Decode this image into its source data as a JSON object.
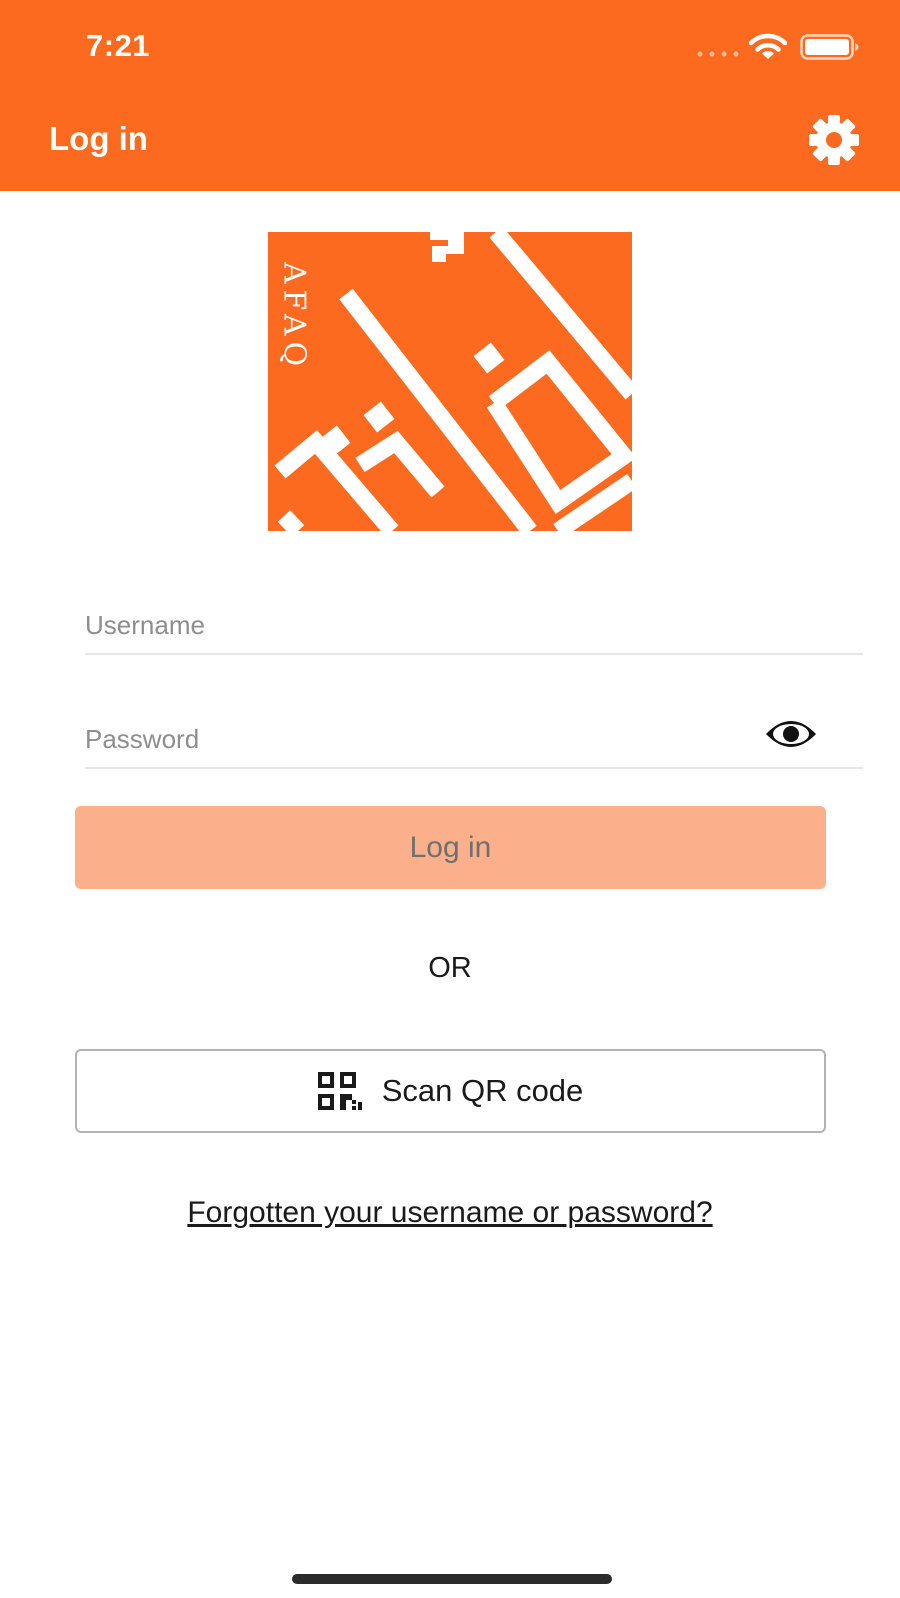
{
  "status_bar": {
    "time": "7:21",
    "icons": [
      "signal-icon",
      "wifi-icon",
      "battery-icon"
    ]
  },
  "header": {
    "title": "Log in",
    "settings_icon": "gear-icon"
  },
  "logo": {
    "text": "AFAQ",
    "color": "#fb6a1f"
  },
  "form": {
    "username_placeholder": "Username",
    "password_placeholder": "Password",
    "show_password_icon": "eye-icon",
    "login_label": "Log in",
    "or_label": "OR",
    "scan_label": "Scan QR code",
    "scan_icon": "qr-code-icon",
    "forgot_label": "Forgotten your username or password?"
  },
  "colors": {
    "primary": "#fb6a1f",
    "login_button_disabled": "#fbb08b",
    "text": "#1a1a1a"
  }
}
